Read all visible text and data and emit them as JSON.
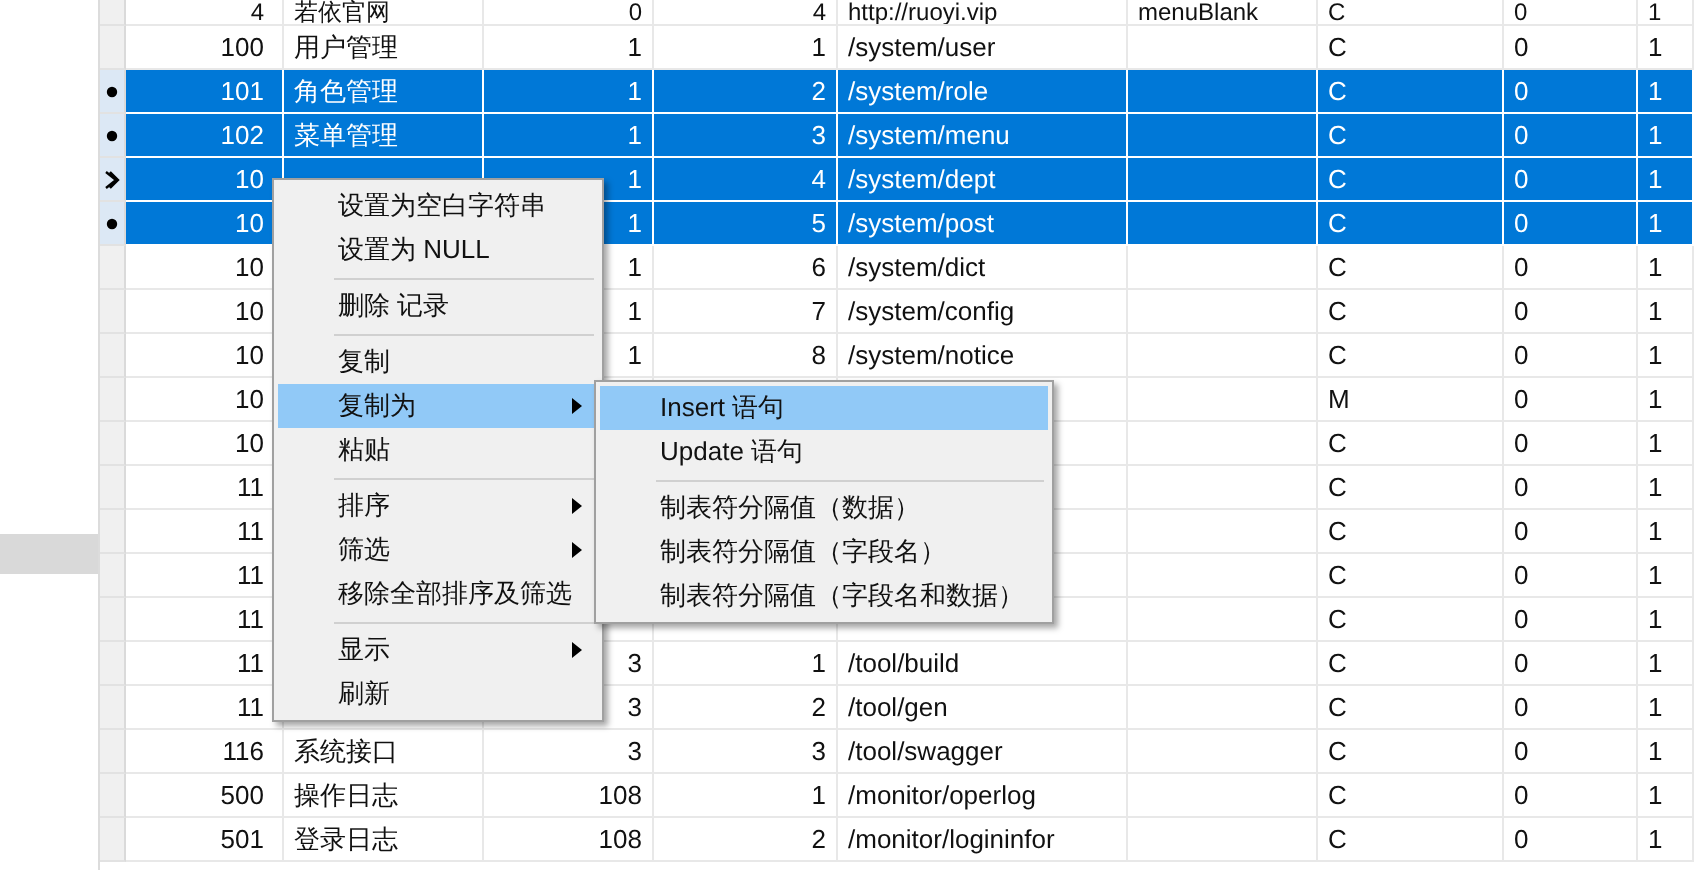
{
  "table": {
    "rows": [
      {
        "id": "4",
        "name": "若依官网",
        "parent": "0",
        "order": "4",
        "url": "http://ruoyi.vip",
        "target": "menuBlank",
        "type": "C",
        "visible": "0",
        "status": "1",
        "selected": false
      },
      {
        "id": "100",
        "name": "用户管理",
        "parent": "1",
        "order": "1",
        "url": "/system/user",
        "type": "C",
        "visible": "0",
        "status": "1",
        "selected": false
      },
      {
        "id": "101",
        "name": "角色管理",
        "parent": "1",
        "order": "2",
        "url": "/system/role",
        "type": "C",
        "visible": "0",
        "status": "1",
        "selected": true
      },
      {
        "id": "102",
        "name": "菜单管理",
        "parent": "1",
        "order": "3",
        "url": "/system/menu",
        "type": "C",
        "visible": "0",
        "status": "1",
        "selected": true
      },
      {
        "id": "10",
        "parent": "1",
        "order": "4",
        "url": "/system/dept",
        "type": "C",
        "visible": "0",
        "status": "1",
        "selected": true,
        "current": true
      },
      {
        "id": "10",
        "parent": "1",
        "order": "5",
        "url": "/system/post",
        "type": "C",
        "visible": "0",
        "status": "1",
        "selected": true
      },
      {
        "id": "10",
        "parent": "1",
        "order": "6",
        "url": "/system/dict",
        "type": "C",
        "visible": "0",
        "status": "1",
        "selected": false
      },
      {
        "id": "10",
        "parent": "1",
        "order": "7",
        "url": "/system/config",
        "type": "C",
        "visible": "0",
        "status": "1",
        "selected": false
      },
      {
        "id": "10",
        "parent": "1",
        "order": "8",
        "url": "/system/notice",
        "type": "C",
        "visible": "0",
        "status": "1",
        "selected": false
      },
      {
        "id": "10",
        "type": "M",
        "visible": "0",
        "status": "1",
        "selected": false
      },
      {
        "id": "10",
        "type": "C",
        "visible": "0",
        "status": "1",
        "selected": false
      },
      {
        "id": "11",
        "type": "C",
        "visible": "0",
        "status": "1",
        "selected": false
      },
      {
        "id": "11",
        "type": "C",
        "visible": "0",
        "status": "1",
        "selected": false
      },
      {
        "id": "11",
        "type": "C",
        "visible": "0",
        "status": "1",
        "selected": false
      },
      {
        "id": "11",
        "type": "C",
        "visible": "0",
        "status": "1",
        "selected": false
      },
      {
        "id": "11",
        "parent": "3",
        "order": "1",
        "url": "/tool/build",
        "type": "C",
        "visible": "0",
        "status": "1",
        "selected": false
      },
      {
        "id": "11",
        "parent": "3",
        "order": "2",
        "url": "/tool/gen",
        "type": "C",
        "visible": "0",
        "status": "1",
        "selected": false
      },
      {
        "id": "116",
        "name": "系统接口",
        "parent": "3",
        "order": "3",
        "url": "/tool/swagger",
        "type": "C",
        "visible": "0",
        "status": "1",
        "selected": false
      },
      {
        "id": "500",
        "name": "操作日志",
        "parent": "108",
        "order": "1",
        "url": "/monitor/operlog",
        "type": "C",
        "visible": "0",
        "status": "1",
        "selected": false
      },
      {
        "id": "501",
        "name": "登录日志",
        "parent": "108",
        "order": "2",
        "url": "/monitor/logininfor",
        "type": "C",
        "visible": "0",
        "status": "1",
        "selected": false
      }
    ]
  },
  "context_menu": {
    "items": [
      {
        "kind": "item",
        "label": "设置为空白字符串",
        "selected": false,
        "submenu": false
      },
      {
        "kind": "item",
        "label": "设置为 NULL",
        "selected": false,
        "submenu": false
      },
      {
        "kind": "separator"
      },
      {
        "kind": "item",
        "label": "删除 记录",
        "selected": false,
        "submenu": false
      },
      {
        "kind": "separator"
      },
      {
        "kind": "item",
        "label": "复制",
        "selected": false,
        "submenu": false
      },
      {
        "kind": "item",
        "label": "复制为",
        "selected": true,
        "submenu": true
      },
      {
        "kind": "item",
        "label": "粘贴",
        "selected": false,
        "submenu": false
      },
      {
        "kind": "separator"
      },
      {
        "kind": "item",
        "label": "排序",
        "selected": false,
        "submenu": true
      },
      {
        "kind": "item",
        "label": "筛选",
        "selected": false,
        "submenu": true
      },
      {
        "kind": "item",
        "label": "移除全部排序及筛选",
        "selected": false,
        "submenu": false
      },
      {
        "kind": "separator"
      },
      {
        "kind": "item",
        "label": "显示",
        "selected": false,
        "submenu": true
      },
      {
        "kind": "item",
        "label": "刷新",
        "selected": false,
        "submenu": false
      }
    ]
  },
  "submenu": {
    "items": [
      {
        "kind": "item",
        "label": "Insert 语句",
        "selected": true,
        "submenu": false
      },
      {
        "kind": "item",
        "label": "Update 语句",
        "selected": false,
        "submenu": false
      },
      {
        "kind": "separator"
      },
      {
        "kind": "item",
        "label": "制表符分隔值（数据）",
        "selected": false,
        "submenu": false
      },
      {
        "kind": "item",
        "label": "制表符分隔值（字段名）",
        "selected": false,
        "submenu": false
      },
      {
        "kind": "item",
        "label": "制表符分隔值（字段名和数据）",
        "selected": false,
        "submenu": false
      }
    ]
  }
}
